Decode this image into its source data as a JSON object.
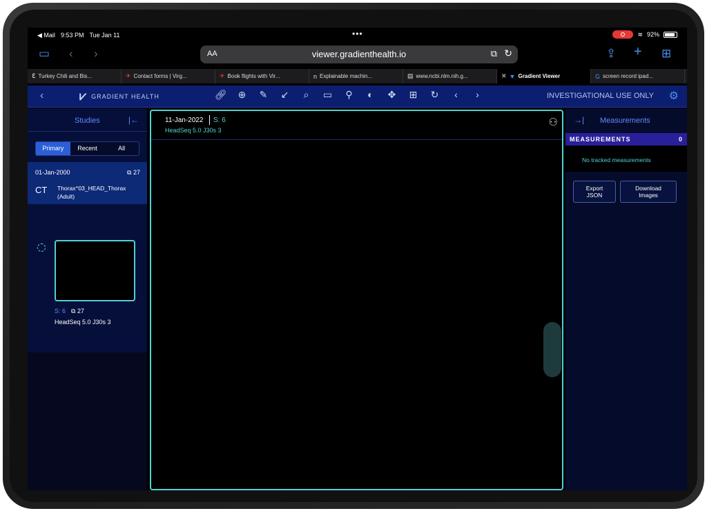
{
  "status": {
    "back_app": "◀ Mail",
    "time": "9:53 PM",
    "date": "Tue Jan 11",
    "battery": "92%"
  },
  "browser": {
    "aa": "AA",
    "url": "viewer.gradienthealth.io"
  },
  "tabs": [
    {
      "label": "Turkey Chili and Bis...",
      "icon": "ℇ"
    },
    {
      "label": "Contact forms | Virg...",
      "icon": "✈"
    },
    {
      "label": "Book flights with Vir...",
      "icon": "✈"
    },
    {
      "label": "Explainable machin...",
      "icon": "n"
    },
    {
      "label": "www.ncbi.nlm.nih.g...",
      "icon": "▤"
    },
    {
      "label": "Gradient Viewer",
      "icon": "▼"
    },
    {
      "label": "screen record ipad...",
      "icon": "G"
    }
  ],
  "app": {
    "brand": "GRADIENT HEALTH",
    "notice": "INVESTIGATIONAL USE ONLY"
  },
  "left": {
    "title": "Studies",
    "segments": [
      "Primary",
      "Recent",
      "All"
    ],
    "study": {
      "date": "01-Jan-2000",
      "count": "27",
      "modality": "CT",
      "description": "Thorax^03_HEAD_Thorax (Adult)"
    },
    "series": {
      "number": "S: 6",
      "count": "27",
      "description": "HeadSeq 5.0 J30s 3"
    }
  },
  "viewport": {
    "date": "11-Jan-2022",
    "series": "S: 6",
    "description": "HeadSeq 5.0 J30s 3"
  },
  "right": {
    "title": "Measurements",
    "header": "MEASUREMENTS",
    "count": "0",
    "empty": "No tracked measurements",
    "export_line1": "Export",
    "export_line2": "JSON",
    "download_line1": "Download",
    "download_line2": "Images"
  },
  "colors": {
    "accent": "#4fd3d6",
    "header_blue": "#0b1e70",
    "active_segment": "#2a5fd8"
  }
}
